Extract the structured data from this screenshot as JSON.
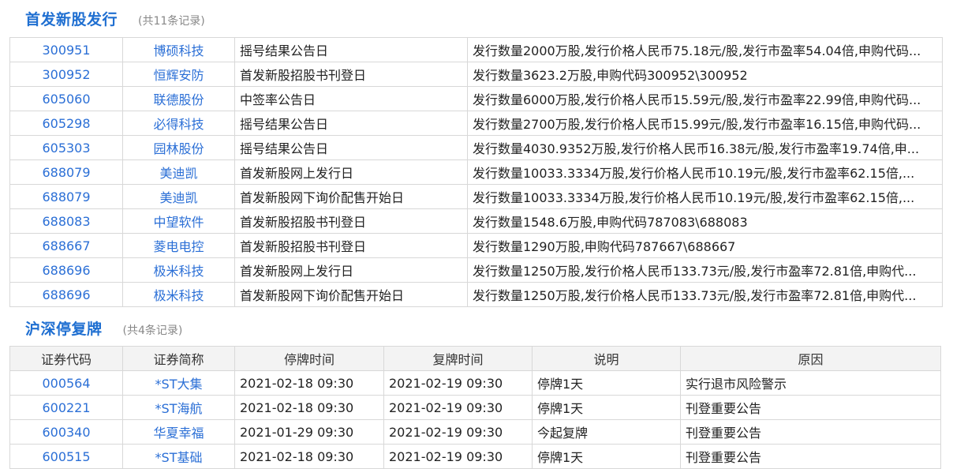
{
  "ipo": {
    "title": "首发新股发行",
    "count": "(共11条记录)",
    "rows": [
      {
        "code": "300951",
        "name": "博硕科技",
        "event": "摇号结果公告日",
        "detail": "发行数量2000万股,发行价格人民币75.18元/股,发行市盈率54.04倍,申购代码..."
      },
      {
        "code": "300952",
        "name": "恒辉安防",
        "event": "首发新股招股书刊登日",
        "detail": "发行数量3623.2万股,申购代码300952\\300952"
      },
      {
        "code": "605060",
        "name": "联德股份",
        "event": "中签率公告日",
        "detail": "发行数量6000万股,发行价格人民币15.59元/股,发行市盈率22.99倍,申购代码..."
      },
      {
        "code": "605298",
        "name": "必得科技",
        "event": "摇号结果公告日",
        "detail": "发行数量2700万股,发行价格人民币15.99元/股,发行市盈率16.15倍,申购代码..."
      },
      {
        "code": "605303",
        "name": "园林股份",
        "event": "摇号结果公告日",
        "detail": "发行数量4030.9352万股,发行价格人民币16.38元/股,发行市盈率19.74倍,申..."
      },
      {
        "code": "688079",
        "name": "美迪凯",
        "event": "首发新股网上发行日",
        "detail": "发行数量10033.3334万股,发行价格人民币10.19元/股,发行市盈率62.15倍,..."
      },
      {
        "code": "688079",
        "name": "美迪凯",
        "event": "首发新股网下询价配售开始日",
        "detail": "发行数量10033.3334万股,发行价格人民币10.19元/股,发行市盈率62.15倍,..."
      },
      {
        "code": "688083",
        "name": "中望软件",
        "event": "首发新股招股书刊登日",
        "detail": "发行数量1548.6万股,申购代码787083\\688083"
      },
      {
        "code": "688667",
        "name": "菱电电控",
        "event": "首发新股招股书刊登日",
        "detail": "发行数量1290万股,申购代码787667\\688667"
      },
      {
        "code": "688696",
        "name": "极米科技",
        "event": "首发新股网上发行日",
        "detail": "发行数量1250万股,发行价格人民币133.73元/股,发行市盈率72.81倍,申购代..."
      },
      {
        "code": "688696",
        "name": "极米科技",
        "event": "首发新股网下询价配售开始日",
        "detail": "发行数量1250万股,发行价格人民币133.73元/股,发行市盈率72.81倍,申购代..."
      }
    ]
  },
  "suspension": {
    "title": "沪深停复牌",
    "count": "(共4条记录)",
    "headers": [
      "证券代码",
      "证券简称",
      "停牌时间",
      "复牌时间",
      "说明",
      "原因"
    ],
    "rows": [
      {
        "code": "000564",
        "name": "*ST大集",
        "halt": "2021-02-18 09:30",
        "resume": "2021-02-19 09:30",
        "note": "停牌1天",
        "reason": "实行退市风险警示"
      },
      {
        "code": "600221",
        "name": "*ST海航",
        "halt": "2021-02-18 09:30",
        "resume": "2021-02-19 09:30",
        "note": "停牌1天",
        "reason": "刊登重要公告"
      },
      {
        "code": "600340",
        "name": "华夏幸福",
        "halt": "2021-01-29 09:30",
        "resume": "2021-02-19 09:30",
        "note": "今起复牌",
        "reason": "刊登重要公告"
      },
      {
        "code": "600515",
        "name": "*ST基础",
        "halt": "2021-02-18 09:30",
        "resume": "2021-02-19 09:30",
        "note": "停牌1天",
        "reason": "刊登重要公告"
      }
    ]
  },
  "colors": {
    "accent": "#1f6fd1",
    "link": "#2b6fd6",
    "header_bg": "#f3f3f3",
    "border": "#d8d8d8"
  }
}
